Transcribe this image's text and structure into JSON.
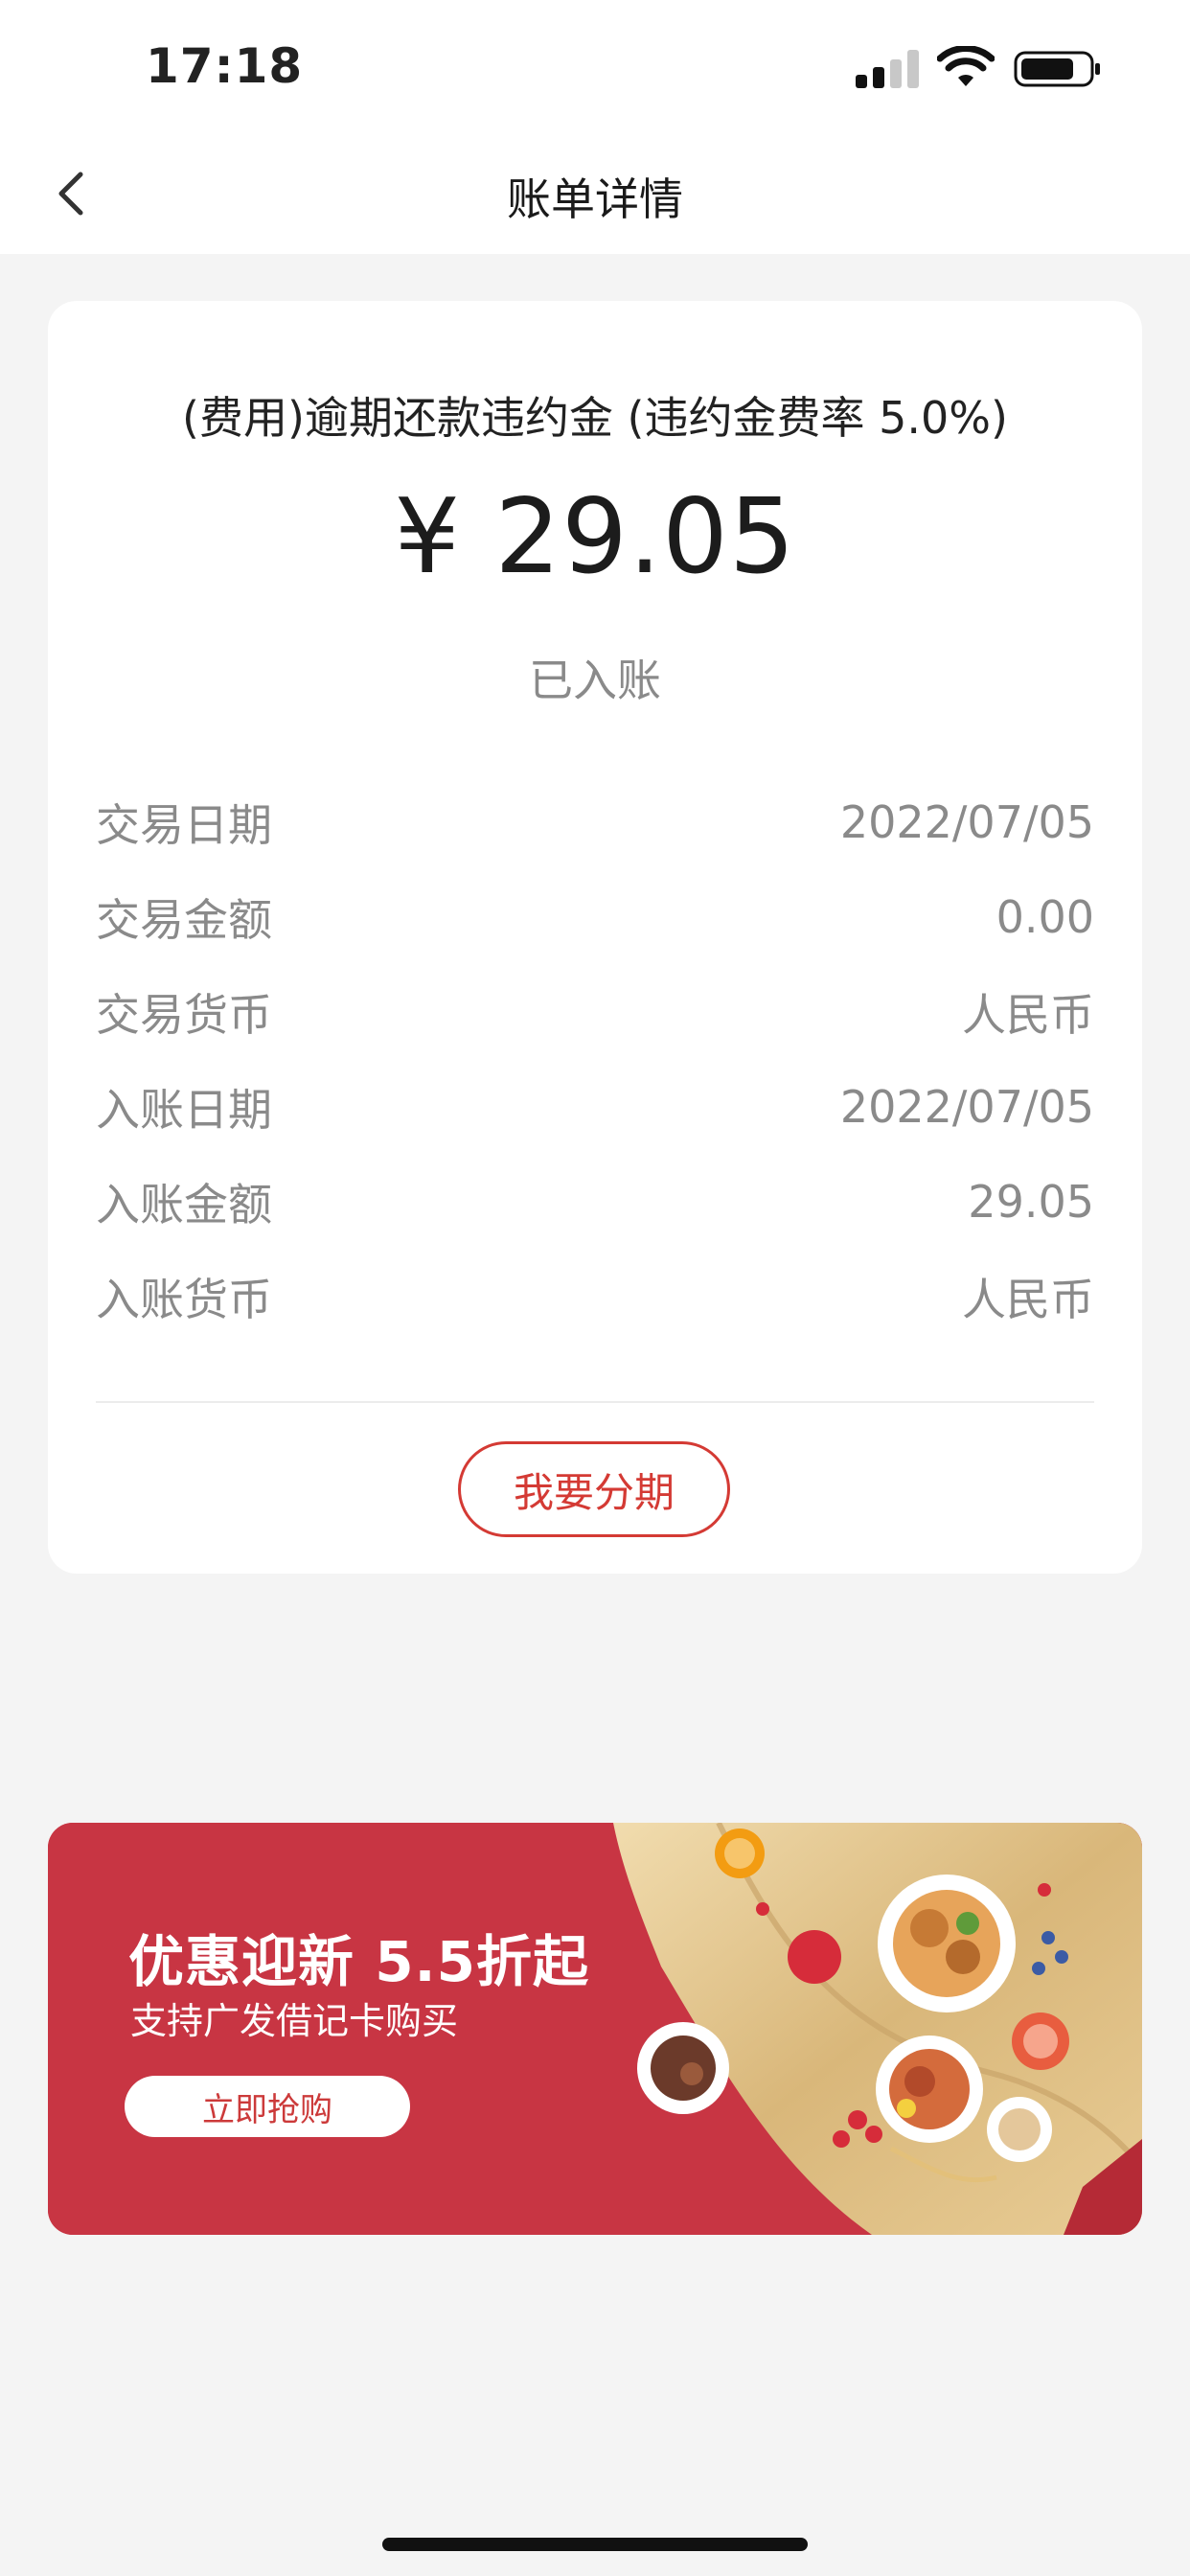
{
  "status_bar": {
    "time": "17:18"
  },
  "nav": {
    "title": "账单详情"
  },
  "bill": {
    "title": "(费用)逾期还款违约金 (违约金费率 5.0%)",
    "amount": "¥ 29.05",
    "status": "已入账",
    "details": [
      {
        "label": "交易日期",
        "value": "2022/07/05"
      },
      {
        "label": "交易金额",
        "value": "0.00"
      },
      {
        "label": "交易货币",
        "value": "人民币"
      },
      {
        "label": "入账日期",
        "value": "2022/07/05"
      },
      {
        "label": "入账金额",
        "value": "29.05"
      },
      {
        "label": "入账货币",
        "value": "人民币"
      }
    ],
    "installment_label": "我要分期"
  },
  "banner": {
    "title": "优惠迎新  5.5折起",
    "subtitle": "支持广发借记卡购买",
    "button_label": "立即抢购"
  },
  "colors": {
    "accent": "#d43a34",
    "banner_red": "#c83543",
    "page_bg": "#f4f4f4"
  }
}
